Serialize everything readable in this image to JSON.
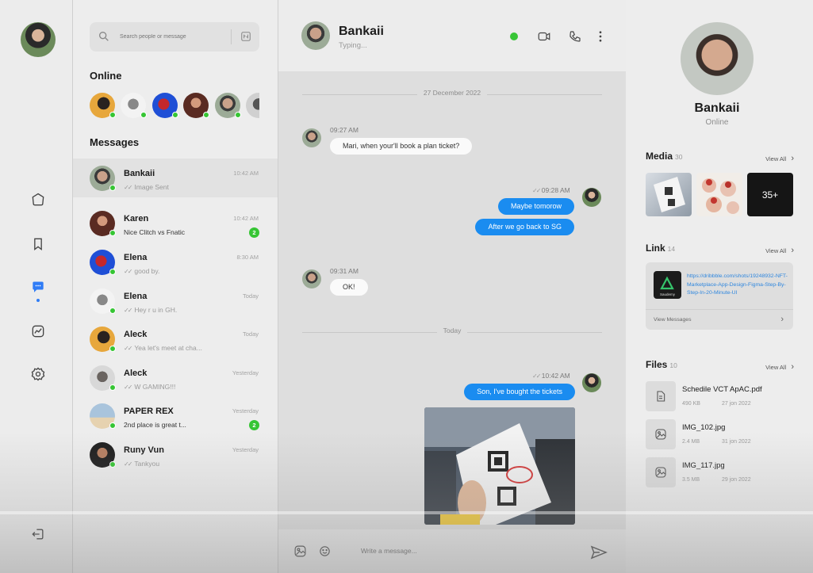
{
  "search": {
    "placeholder": "Search people or message"
  },
  "sections": {
    "online": "Online",
    "messages": "Messages"
  },
  "conversations": [
    {
      "name": "Bankaii",
      "preview": "Image Sent",
      "time": "10:42 AM",
      "ticks": true
    },
    {
      "name": "Karen",
      "preview": "Nice Clitch vs Fnatic",
      "time": "10:42 AM",
      "badge": "2"
    },
    {
      "name": "Elena",
      "preview": "good by.",
      "time": "8:30 AM",
      "ticks": true
    },
    {
      "name": "Elena",
      "preview": "Hey r u in GH.",
      "time": "Today",
      "ticks": true
    },
    {
      "name": "Aleck",
      "preview": "Yea let's meet at cha...",
      "time": "Today",
      "ticks": true
    },
    {
      "name": "Aleck",
      "preview": "W GAMING!!!",
      "time": "Yesterday",
      "ticks": true
    },
    {
      "name": "PAPER REX",
      "preview": "2nd place is great t...",
      "time": "Yesterday",
      "badge": "2"
    },
    {
      "name": "Runy Vun",
      "preview": "Tankyou",
      "time": "Yesterday",
      "ticks": true
    }
  ],
  "chat": {
    "name": "Bankaii",
    "status": "Typing...",
    "date1": "27 December 2022",
    "date2": "Today",
    "messages": [
      {
        "time": "09:27 AM",
        "text": "Mari, when your'll book a plan ticket?"
      },
      {
        "time": "09:28 AM",
        "text": "Maybe tomorow"
      },
      {
        "text": "After we go back to SG"
      },
      {
        "time": "09:31 AM",
        "text": "OK!"
      },
      {
        "time": "10:42 AM",
        "text": "Son, I've bought the tickets"
      }
    ],
    "composer_placeholder": "Write a message..."
  },
  "profile": {
    "name": "Bankaii",
    "status": "Online",
    "media_label": "Media",
    "media_count": "30",
    "media_more": "35+",
    "link_label": "Link",
    "link_count": "14",
    "link_url": "https://dribbble.com/shots/19248932-NFT-Marketplace-App-Design-Figma-Step-By-Step-In-20-Minute-UI",
    "link_brand": "Saudemy",
    "view_messages": "View Messages",
    "files_label": "Files",
    "files_count": "10",
    "view_all": "View All",
    "files": [
      {
        "name": "Schedile VCT ApAC.pdf",
        "size": "490 KB",
        "date": "27 jon 2022",
        "icon": "document-icon"
      },
      {
        "name": "IMG_102.jpg",
        "size": "2.4 MB",
        "date": "31 jon 2022",
        "icon": "image-file-icon"
      },
      {
        "name": "IMG_117.jpg",
        "size": "3.5 MB",
        "date": "29 jon 2022",
        "icon": "image-file-icon"
      }
    ]
  },
  "colors": {
    "accent": "#1a8cf0",
    "online": "#36c534"
  }
}
